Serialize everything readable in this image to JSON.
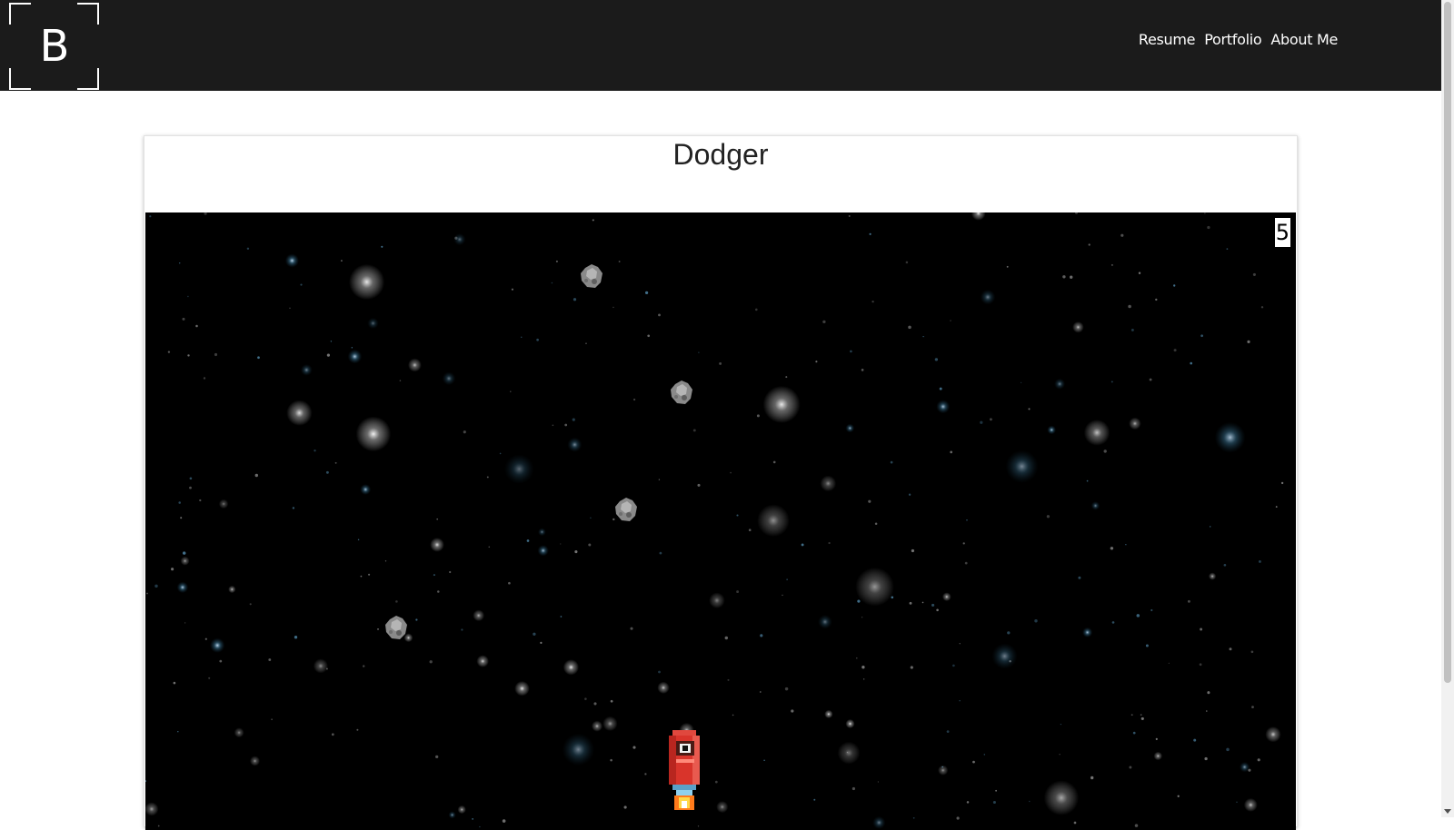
{
  "header": {
    "logo_letter": "B",
    "nav": [
      {
        "label": "Resume"
      },
      {
        "label": "Portfolio"
      },
      {
        "label": "About Me"
      }
    ]
  },
  "game": {
    "title": "Dodger",
    "score": "5"
  },
  "colors": {
    "header_bg": "#1b1b1b",
    "canvas_bg": "#000000",
    "ship_red": "#d9342b"
  }
}
